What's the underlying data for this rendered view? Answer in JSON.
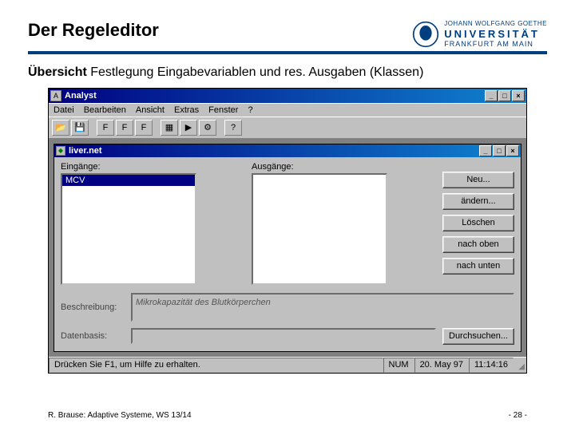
{
  "slide": {
    "title": "Der Regeleditor",
    "subtitle_bold": "Übersicht",
    "subtitle_rest": " Festlegung  Eingabevariablen und res. Ausgaben (Klassen)"
  },
  "logo": {
    "line1": "JOHANN WOLFGANG GOETHE",
    "line2": "UNIVERSITÄT",
    "line3": "FRANKFURT AM MAIN"
  },
  "app": {
    "title": "Analyst",
    "menus": [
      "Datei",
      "Bearbeiten",
      "Ansicht",
      "Extras",
      "Fenster",
      "?"
    ],
    "child_title": "liver.net",
    "labels": {
      "inputs": "Eingänge:",
      "outputs": "Ausgänge:"
    },
    "input_selected": "MCV",
    "buttons": {
      "new": "Neu...",
      "edit": "ändern...",
      "delete": "Löschen",
      "up": "nach oben",
      "down": "nach unten",
      "browse": "Durchsuchen..."
    },
    "desc_label": "Beschreibung:",
    "desc_value": "Mikrokapazität des Blutkörperchen",
    "db_label": "Datenbasis:",
    "status": {
      "hint": "Drücken Sie F1, um Hilfe zu erhalten.",
      "caps": "NUM",
      "date": "20. May 97",
      "time": "11:14:16"
    },
    "winbtns": {
      "min": "_",
      "max": "□",
      "close": "×"
    }
  },
  "footer": {
    "left": "R. Brause: Adaptive Systeme, WS 13/14",
    "right": "- 28 -"
  }
}
